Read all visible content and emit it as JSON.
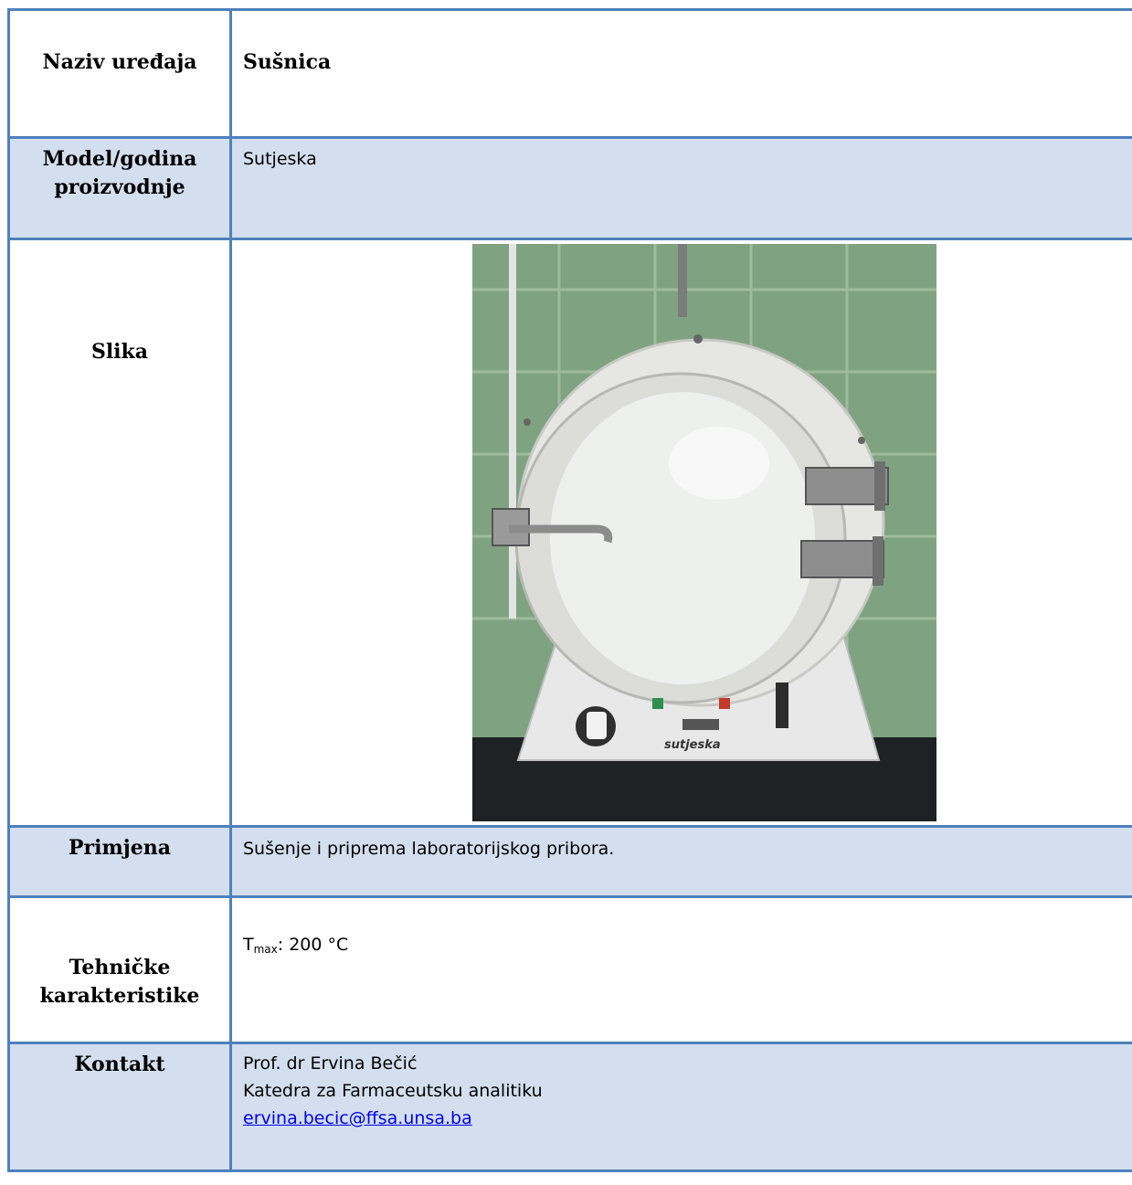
{
  "rows": {
    "name": {
      "label": "Naziv uređaja",
      "value": "Sušnica"
    },
    "model": {
      "label_line1": "Model/godina",
      "label_line2": "proizvodnje",
      "value": "Sutjeska"
    },
    "image": {
      "label": "Slika",
      "brand_on_device": "sutjeska"
    },
    "use": {
      "label": "Primjena",
      "value": "Sušenje i priprema laboratorijskog pribora."
    },
    "tech": {
      "label_line1": "Tehničke",
      "label_line2": "karakteristike",
      "symbol": "T",
      "subscript": "max",
      "value": ": 200 °C"
    },
    "contact": {
      "label": "Kontakt",
      "person": "Prof. dr Ervina Bečić",
      "department": "Katedra za Farmaceutsku analitiku",
      "email": "ervina.becic@ffsa.unsa.ba"
    }
  },
  "colors": {
    "border": "#4f81bd",
    "alt_row": "#d3dfee",
    "link": "#0000ee"
  }
}
